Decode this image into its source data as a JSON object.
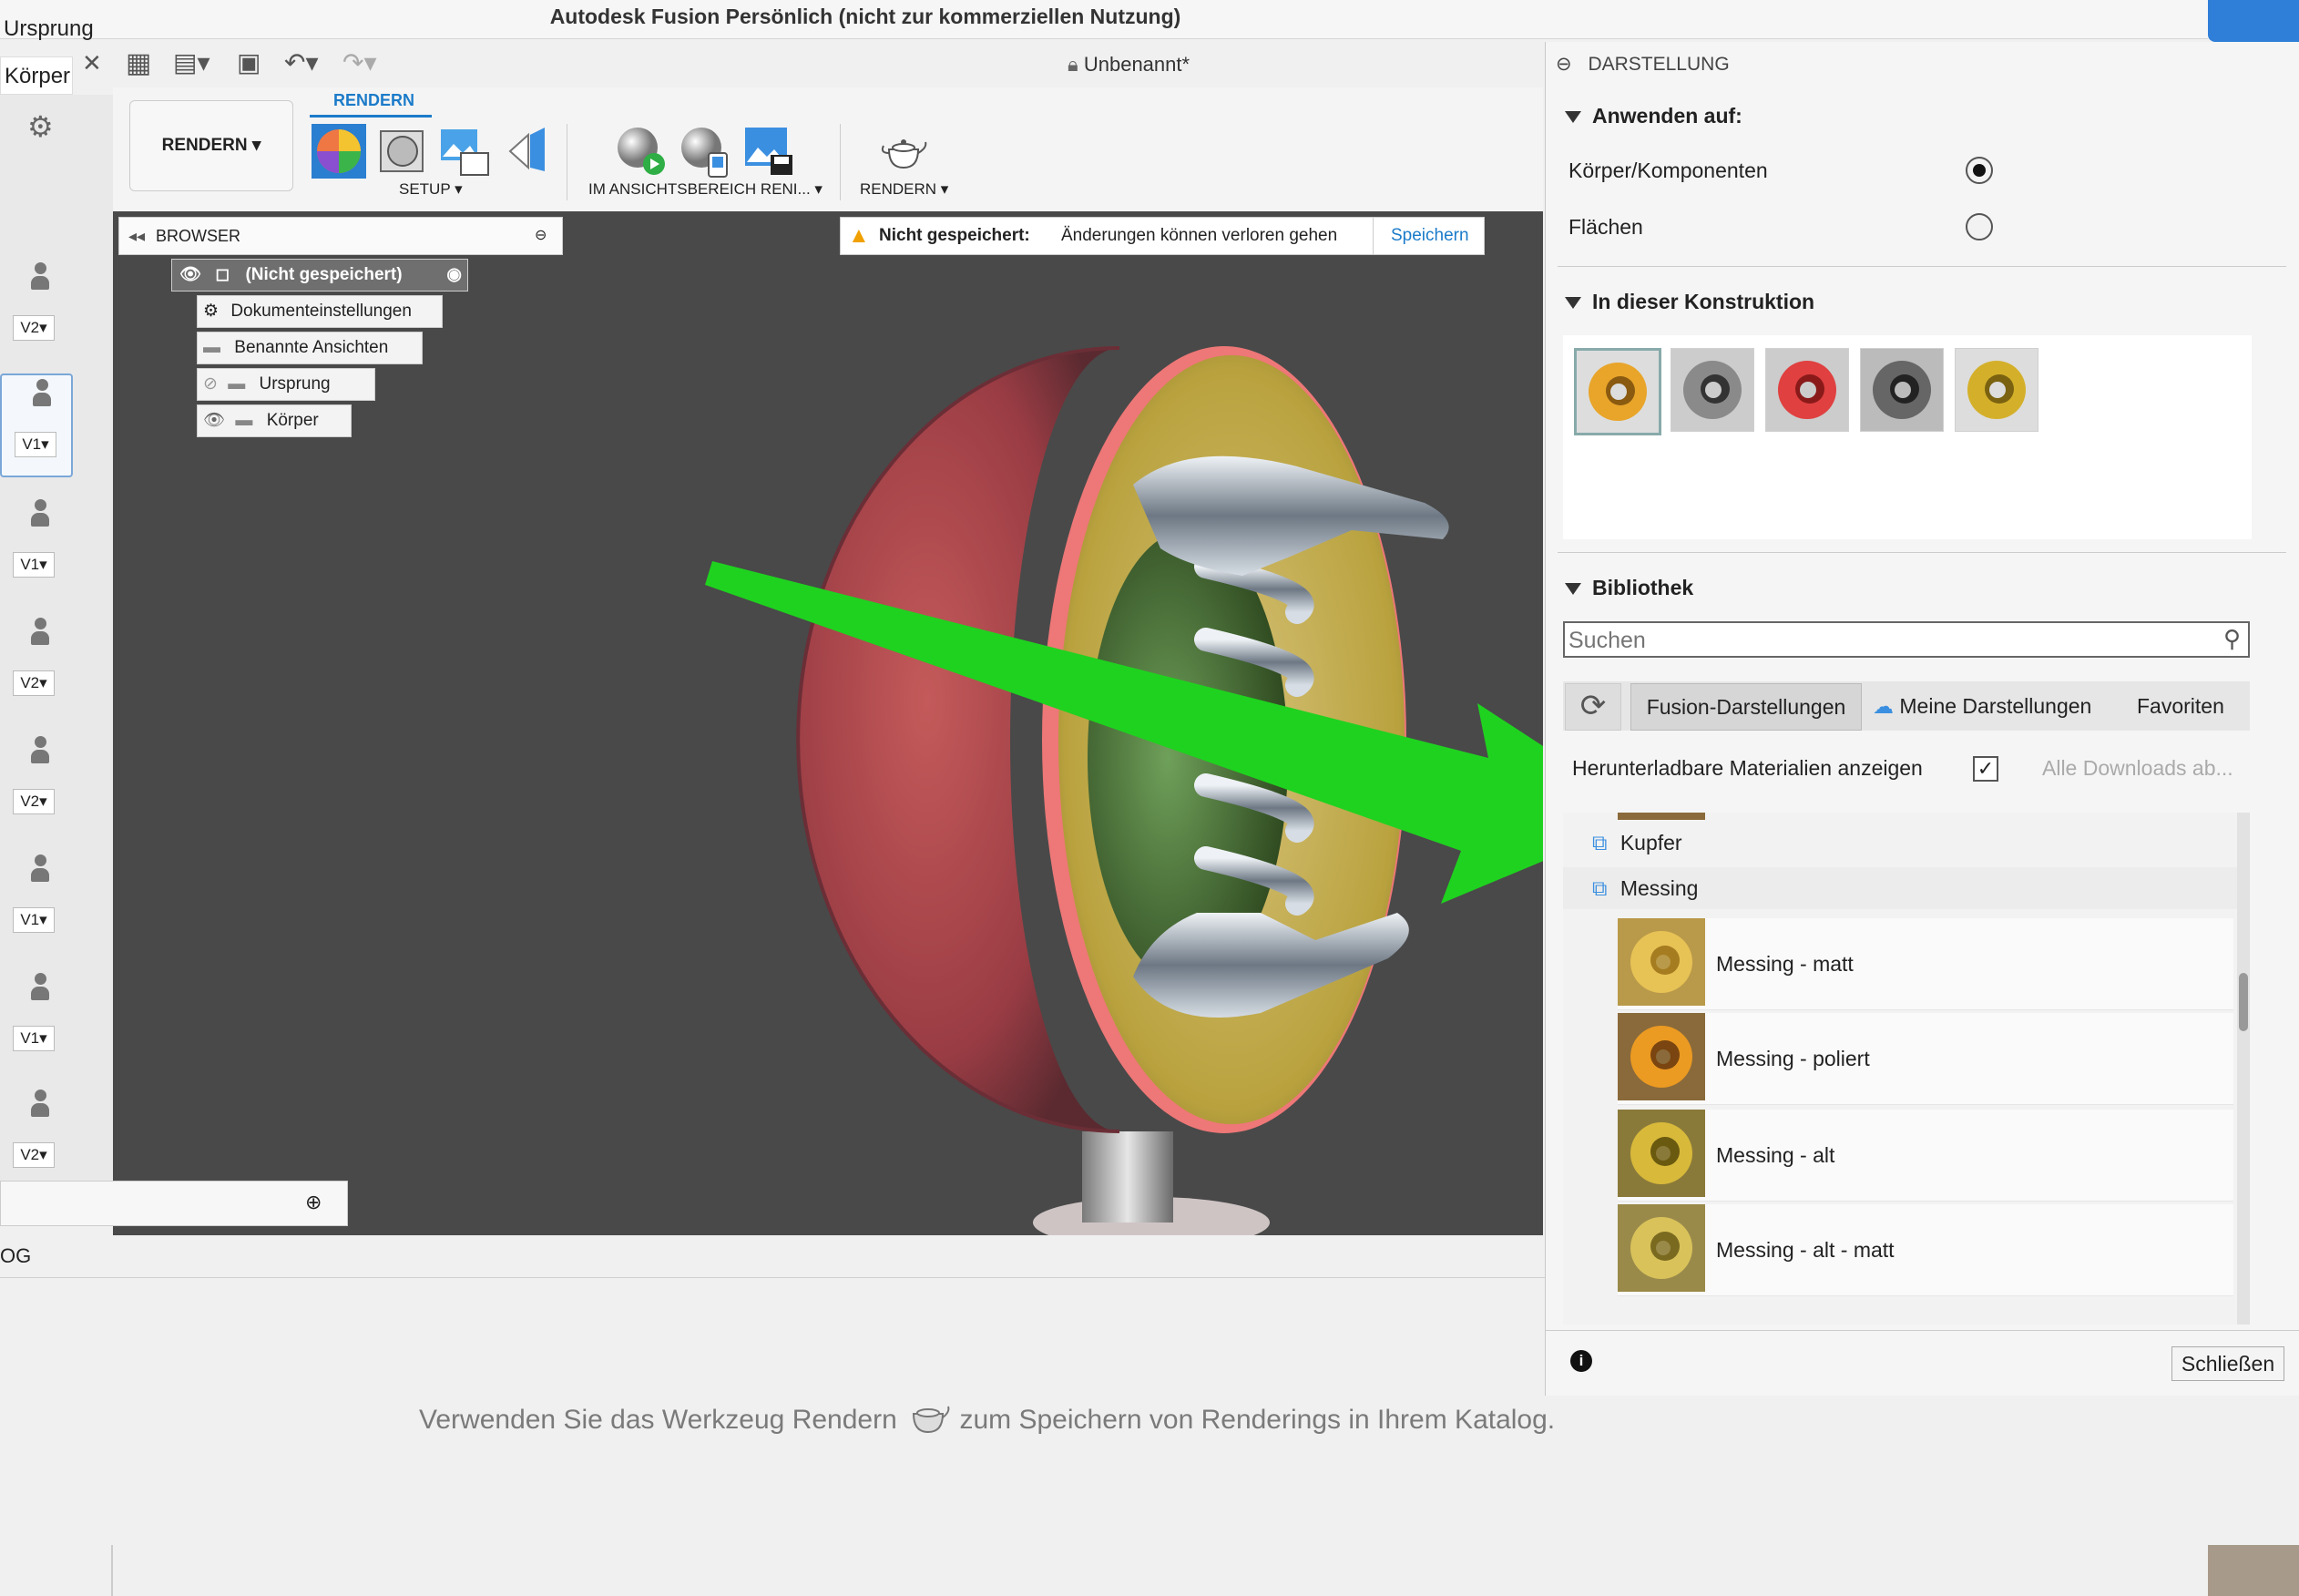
{
  "window": {
    "title": "Autodesk Fusion Persönlich (nicht zur kommerziellen Nutzung)",
    "document_title": "Unbenannt*"
  },
  "left_edge": {
    "label1": "Ursprung",
    "label2": "Körper",
    "status_fragment": "OG"
  },
  "versions": [
    "V2",
    "V1",
    "V1",
    "V2",
    "V2",
    "V1",
    "V1",
    "V2"
  ],
  "ribbon": {
    "workspace_button": "RENDERN",
    "active_tab": "RENDERN",
    "groups": [
      {
        "label": "SETUP"
      },
      {
        "label": "IM ANSICHTSBEREICH RENI..."
      },
      {
        "label": "RENDERN"
      }
    ]
  },
  "browser": {
    "title": "BROWSER",
    "root": "(Nicht gespeichert)",
    "items": [
      "Dokumenteinstellungen",
      "Benannte Ansichten",
      "Ursprung",
      "Körper"
    ]
  },
  "warning": {
    "title": "Nicht gespeichert:",
    "message": "Änderungen können verloren gehen",
    "action": "Speichern"
  },
  "panel": {
    "title": "DARSTELLUNG",
    "apply_section": "Anwenden auf:",
    "apply_options": [
      {
        "label": "Körper/Komponenten",
        "selected": true
      },
      {
        "label": "Flächen",
        "selected": false
      }
    ],
    "in_design_section": "In dieser Konstruktion",
    "library_section": "Bibliothek",
    "search_placeholder": "Suchen",
    "tabs": [
      "Fusion-Darstellungen",
      "Meine Darstellungen",
      "Favoriten"
    ],
    "downloadable_label": "Herunterladbare Materialien anzeigen",
    "downloadable_checked": true,
    "all_downloads": "Alle Downloads ab...",
    "folders": [
      "Kupfer",
      "Messing"
    ],
    "items": [
      "Messing - matt",
      "Messing - poliert",
      "Messing - alt",
      "Messing - alt - matt"
    ],
    "close_button": "Schließen"
  },
  "hint": {
    "before": "Verwenden Sie das Werkzeug Rendern",
    "after": "zum Speichern von Renderings in Ihrem Katalog."
  },
  "colors": {
    "accent": "#1b7bc9",
    "arrow": "#1fd21f",
    "viewport": "#494949"
  }
}
